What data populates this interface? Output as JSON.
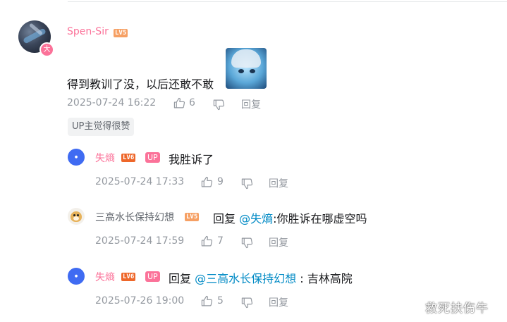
{
  "comment": {
    "username": "Spen-Sir",
    "level": "LV5",
    "avatar_badge": "大",
    "text": "得到教训了没，以后还敢不敢",
    "time": "2025-07-24 16:22",
    "likes": "6",
    "reply_label": "回复",
    "up_liked_chip": "UP主觉得很赞",
    "colors": {
      "username": "#fb7299",
      "level_bg": "#f6a064"
    }
  },
  "replies": [
    {
      "username": "失熵",
      "level": "LV6",
      "up_tag": "UP",
      "prefix": "",
      "mention": "",
      "sep": "",
      "text": "我胜诉了",
      "time": "2025-07-24 17:33",
      "likes": "9",
      "reply_label": "回复"
    },
    {
      "username": "三高水长保持幻想",
      "level": "LV5",
      "prefix": "回复",
      "mention": "@失熵",
      "sep": ":",
      "text": "你胜诉在哪虚空吗",
      "time": "2025-07-24 17:59",
      "likes": "7",
      "reply_label": "回复"
    },
    {
      "username": "失熵",
      "level": "LV6",
      "up_tag": "UP",
      "prefix": "回复",
      "mention": "@三高水长保持幻想",
      "sep": " : ",
      "text": "吉林高院",
      "time": "2025-07-26 19:00",
      "likes": "5",
      "reply_label": "回复"
    }
  ],
  "watermark": "救死扶伤牛",
  "icons": {
    "like": "thumbs-up-icon",
    "dislike": "thumbs-down-icon"
  }
}
